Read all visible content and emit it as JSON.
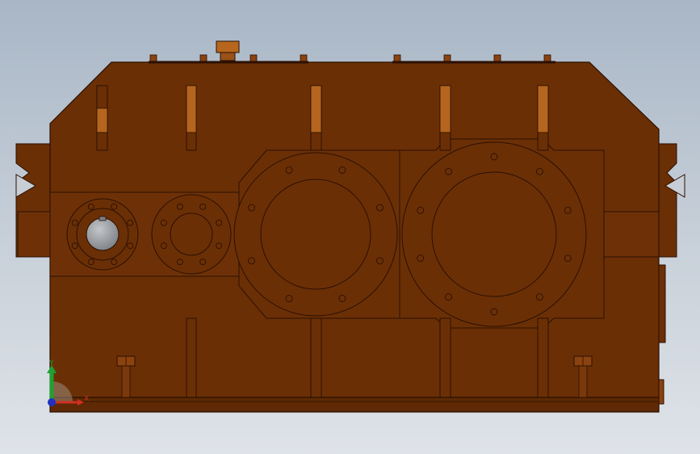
{
  "colors": {
    "viewport_top": "#a8b6c6",
    "viewport_bottom": "#dfe3e8",
    "housing_fill": "#6b2f06",
    "housing_light": "#8a4210",
    "rib_fill": "#b5651d",
    "edge_line": "#2a1000",
    "shaft_fill": "#8f9296",
    "foot_fill": "#5e2904"
  },
  "model": {
    "icon": "gearbox-housing-3d-model",
    "bearing_bores": 4,
    "bolt_counts": [
      8,
      8,
      8,
      10
    ]
  },
  "triad": {
    "x_label": "X",
    "y_label": "Y",
    "x_color": "#d03020",
    "y_color": "#20a030",
    "z_color": "#2030c0"
  }
}
